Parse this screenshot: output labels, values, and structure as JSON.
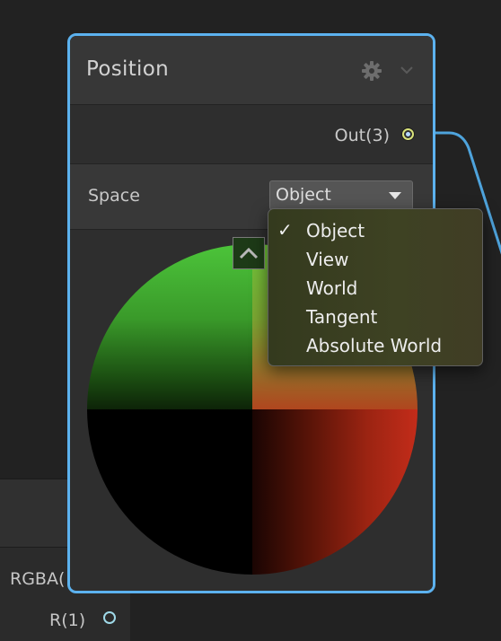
{
  "node": {
    "title": "Position",
    "output_label": "Out(3)",
    "space_label": "Space",
    "space_value": "Object"
  },
  "dropdown": {
    "items": [
      {
        "label": "Object",
        "selected": true
      },
      {
        "label": "View",
        "selected": false
      },
      {
        "label": "World",
        "selected": false
      },
      {
        "label": "Tangent",
        "selected": false
      },
      {
        "label": "Absolute World",
        "selected": false
      }
    ],
    "check_glyph": "✓"
  },
  "background_node": {
    "port_label_rgba": "RGBA(",
    "port_label_r": "R(1)"
  },
  "icons": {
    "settings": "gear-icon",
    "collapse": "chevron-down-icon",
    "preview_toggle": "chevron-up-icon"
  },
  "colors": {
    "selection_border": "#5cb2ef",
    "port_outline": "#d9e27a",
    "wire": "#4ea3dc"
  }
}
